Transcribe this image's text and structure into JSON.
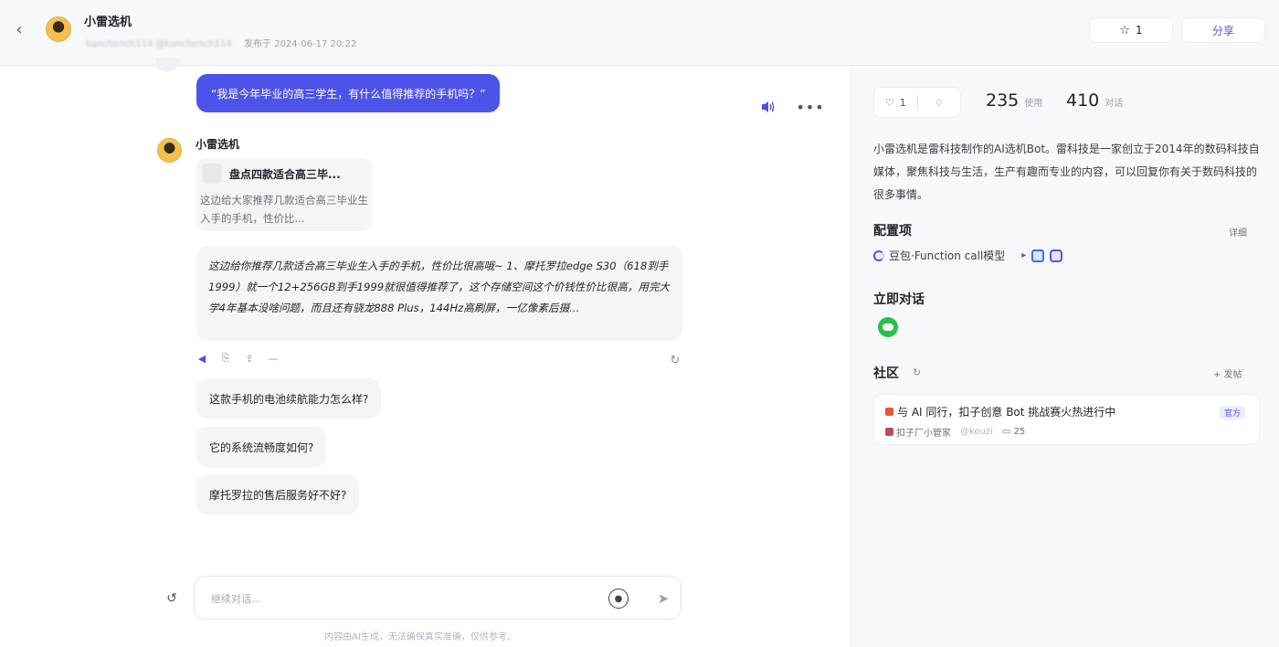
{
  "header": {
    "title": "小雷选机",
    "author_handle": "kanchench114 @kanchench114",
    "published": "发布于 2024-06-17 20:22",
    "favorites_count": "1",
    "share_label": "分享"
  },
  "chat": {
    "user_message": "“我是今年毕业的高三学生，有什么值得推荐的手机吗？”",
    "bot_name": "小雷选机",
    "card_title": "盘点四款适合高三毕...",
    "card_desc": "这边给大家推荐几款适合高三毕业生入手的手机，性价比...",
    "reply": "这边给你推荐几款适合高三毕业生入手的手机，性价比很高哦~ 1、摩托罗拉edge S30（618到手1999）就一个12+256GB到手1999就很值得推荐了，这个存储空间这个价钱性价比很高，用完大学4年基本没啥问题，而且还有骁龙888 Plus，144Hz高刷屏，一亿像素后摄...",
    "suggestions": [
      "这款手机的电池续航能力怎么样?",
      "它的系统流畅度如何?",
      "摩托罗拉的售后服务好不好?"
    ],
    "input_placeholder": "继续对话...",
    "disclaimer": "内容由AI生成，无法确保真实准确，仅供参考。"
  },
  "sidebar": {
    "like_count": "1",
    "stats": [
      {
        "value": "235",
        "label": "使用"
      },
      {
        "value": "410",
        "label": "对话"
      }
    ],
    "description": "小雷选机是雷科技制作的AI选机Bot。雷科技是一家创立于2014年的数码科技自媒体，聚焦科技与生活，生产有趣而专业的内容，可以回复你有关于数码科技的很多事情。",
    "config_title": "配置项",
    "config_detail": "详细",
    "model_name": "豆包·Function call模型",
    "chat_now_title": "立即对话",
    "community_title": "社区",
    "post_link": "+ 发帖",
    "post": {
      "title": "与 AI 同行，扣子创意 Bot 挑战赛火热进行中",
      "badge": "官方",
      "author": "扣子厂小管家",
      "handle": "@kouzi",
      "comments": "25"
    }
  },
  "colors": {
    "accent": "#4d53e8",
    "bubble_gray": "#f4f5f7",
    "wechat_green": "#27c24c"
  },
  "icons": {
    "back": "chevron-left-icon",
    "favorite": "star-icon",
    "speaker": "speaker-icon",
    "more": "ellipsis-icon",
    "send": "send-icon"
  }
}
